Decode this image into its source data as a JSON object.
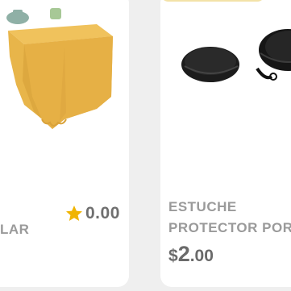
{
  "products": [
    {
      "name_fragment": "LAR",
      "rating": "0.00",
      "image": "yellow-tablecloth",
      "rating_icon": "star-icon"
    },
    {
      "name_line1": "ESTUCHE",
      "name_line2": "PROTECTOR PORT",
      "price_currency": "$",
      "price_whole": "2",
      "price_cents": ".00",
      "image": "black-glasses-case"
    }
  ],
  "colors": {
    "background": "#efefef",
    "card": "#ffffff",
    "text_muted": "#9a9a9a",
    "price": "#6a6a6a",
    "star": "#f0b400",
    "tablecloth": "#e8b54a"
  }
}
